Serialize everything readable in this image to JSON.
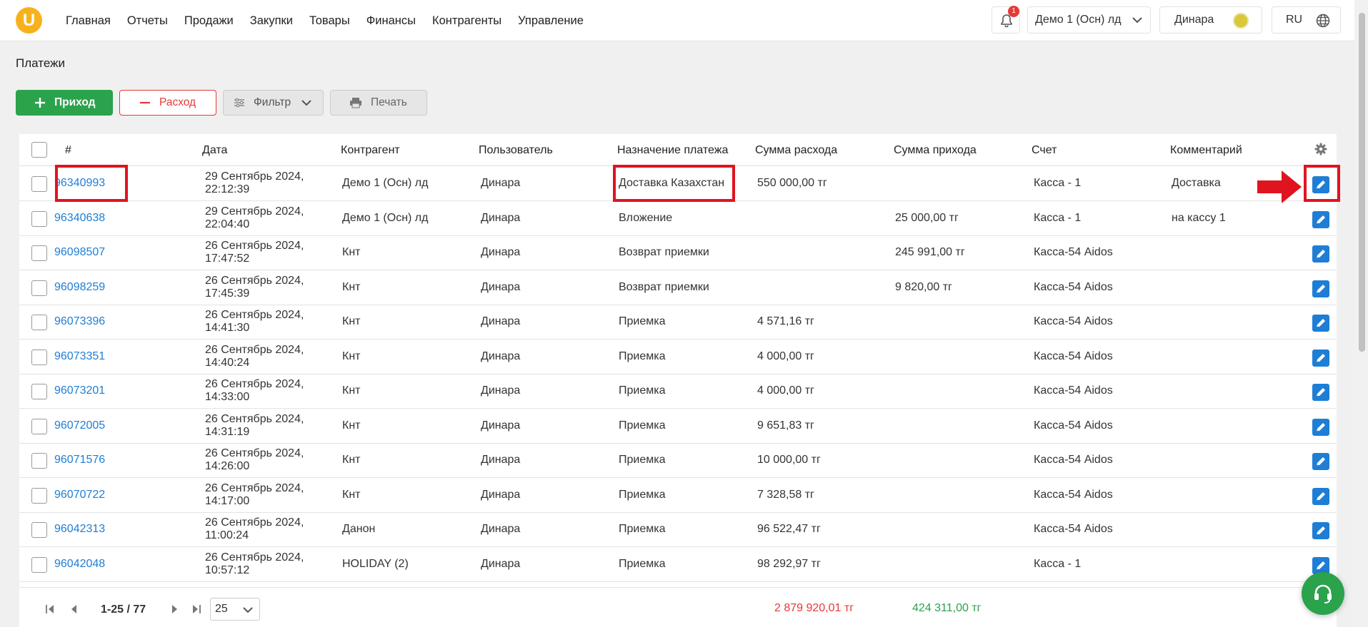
{
  "app": {
    "logo_letter": "U",
    "brand_color": "#f7b21b"
  },
  "nav": [
    "Главная",
    "Отчеты",
    "Продажи",
    "Закупки",
    "Товары",
    "Финансы",
    "Контрагенты",
    "Управление"
  ],
  "header": {
    "notifications_count": "1",
    "org": "Демо 1 (Осн) лд",
    "user": "Динара",
    "lang": "RU"
  },
  "page": {
    "title": "Платежи"
  },
  "toolbar": {
    "income": "Приход",
    "expense": "Расход",
    "filter": "Фильтр",
    "print": "Печать"
  },
  "table": {
    "columns": [
      "#",
      "Дата",
      "Контрагент",
      "Пользователь",
      "Назначение платежа",
      "Сумма расхода",
      "Сумма прихода",
      "Счет",
      "Комментарий"
    ],
    "rows": [
      {
        "id": "96340993",
        "date1": "29 Сентябрь 2024,",
        "date2": "22:12:39",
        "counterparty": "Демо 1 (Осн) лд",
        "user": "Динара",
        "purpose": "Доставка Казахстан",
        "expense": "550 000,00 тг",
        "income": "",
        "account": "Касса - 1",
        "comment": "Доставка"
      },
      {
        "id": "96340638",
        "date1": "29 Сентябрь 2024,",
        "date2": "22:04:40",
        "counterparty": "Демо 1 (Осн) лд",
        "user": "Динара",
        "purpose": "Вложение",
        "expense": "",
        "income": "25 000,00 тг",
        "account": "Касса - 1",
        "comment": "на кассу 1"
      },
      {
        "id": "96098507",
        "date1": "26 Сентябрь 2024,",
        "date2": "17:47:52",
        "counterparty": "Кнт",
        "user": "Динара",
        "purpose": "Возврат приемки",
        "expense": "",
        "income": "245 991,00 тг",
        "account": "Касса-54 Aidos",
        "comment": ""
      },
      {
        "id": "96098259",
        "date1": "26 Сентябрь 2024,",
        "date2": "17:45:39",
        "counterparty": "Кнт",
        "user": "Динара",
        "purpose": "Возврат приемки",
        "expense": "",
        "income": "9 820,00 тг",
        "account": "Касса-54 Aidos",
        "comment": ""
      },
      {
        "id": "96073396",
        "date1": "26 Сентябрь 2024,",
        "date2": "14:41:30",
        "counterparty": "Кнт",
        "user": "Динара",
        "purpose": "Приемка",
        "expense": "4 571,16 тг",
        "income": "",
        "account": "Касса-54 Aidos",
        "comment": ""
      },
      {
        "id": "96073351",
        "date1": "26 Сентябрь 2024,",
        "date2": "14:40:24",
        "counterparty": "Кнт",
        "user": "Динара",
        "purpose": "Приемка",
        "expense": "4 000,00 тг",
        "income": "",
        "account": "Касса-54 Aidos",
        "comment": ""
      },
      {
        "id": "96073201",
        "date1": "26 Сентябрь 2024,",
        "date2": "14:33:00",
        "counterparty": "Кнт",
        "user": "Динара",
        "purpose": "Приемка",
        "expense": "4 000,00 тг",
        "income": "",
        "account": "Касса-54 Aidos",
        "comment": ""
      },
      {
        "id": "96072005",
        "date1": "26 Сентябрь 2024,",
        "date2": "14:31:19",
        "counterparty": "Кнт",
        "user": "Динара",
        "purpose": "Приемка",
        "expense": "9 651,83 тг",
        "income": "",
        "account": "Касса-54 Aidos",
        "comment": ""
      },
      {
        "id": "96071576",
        "date1": "26 Сентябрь 2024,",
        "date2": "14:26:00",
        "counterparty": "Кнт",
        "user": "Динара",
        "purpose": "Приемка",
        "expense": "10 000,00 тг",
        "income": "",
        "account": "Касса-54 Aidos",
        "comment": ""
      },
      {
        "id": "96070722",
        "date1": "26 Сентябрь 2024,",
        "date2": "14:17:00",
        "counterparty": "Кнт",
        "user": "Динара",
        "purpose": "Приемка",
        "expense": "7 328,58 тг",
        "income": "",
        "account": "Касса-54 Aidos",
        "comment": ""
      },
      {
        "id": "96042313",
        "date1": "26 Сентябрь 2024,",
        "date2": "11:00:24",
        "counterparty": "Данон",
        "user": "Динара",
        "purpose": "Приемка",
        "expense": "96 522,47 тг",
        "income": "",
        "account": "Касса-54 Aidos",
        "comment": ""
      },
      {
        "id": "96042048",
        "date1": "26 Сентябрь 2024,",
        "date2": "10:57:12",
        "counterparty": "HOLIDAY (2)",
        "user": "Динара",
        "purpose": "Приемка",
        "expense": "98 292,97 тг",
        "income": "",
        "account": "Касса - 1",
        "comment": ""
      }
    ]
  },
  "footer": {
    "range": "1-25 / 77",
    "per_page": "25",
    "total_expense": "2 879 920,01 тг",
    "total_income": "424 311,00 тг"
  },
  "colors": {
    "green": "#2ba24c",
    "red": "#e53935",
    "link": "#1e7ed6",
    "highlight": "#e0141e"
  }
}
